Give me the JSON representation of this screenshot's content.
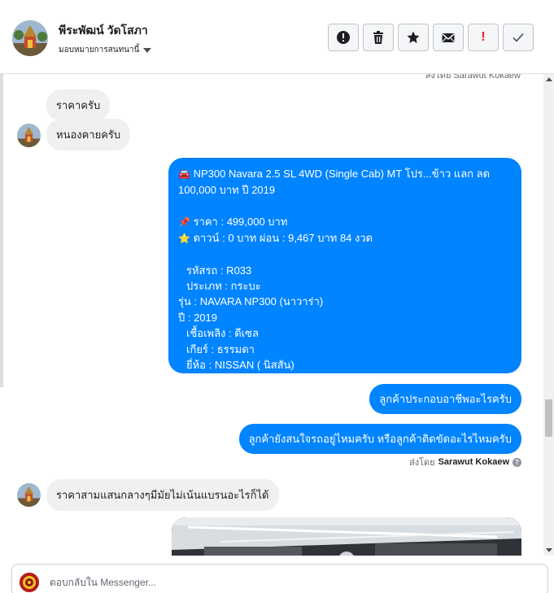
{
  "header": {
    "page_name": "พีระพัฒน์ วัดโสภา",
    "assign_label": "มอบหมายการสนทนานี้",
    "actions": [
      {
        "name": "report-button",
        "icon": "alert-circle-icon"
      },
      {
        "name": "delete-button",
        "icon": "trash-icon"
      },
      {
        "name": "star-button",
        "icon": "star-icon"
      },
      {
        "name": "mark-unread-button",
        "icon": "envelope-icon"
      },
      {
        "name": "spam-button",
        "icon": "exclamation-icon"
      },
      {
        "name": "mark-done-button",
        "icon": "check-icon"
      }
    ]
  },
  "messages": {
    "m1": "ราคาครับ",
    "m2": "หนองคายครับ",
    "listing": {
      "title_1": "NP300 Navara 2.5 SL 4WD (Single Cab) MT โปร...ข้าว แลก ลด",
      "title_2": "100,000 บาท ปี 2019",
      "price": "ราคา : 499,000 บาท",
      "down": "ดาวน์ : 0 บาท ผ่อน : 9,467 บาท 84 งวด",
      "code": "รหัสรถ : R033",
      "type": "ประเภท : กระบะ",
      "model": "รุ่น : NAVARA NP300 (นาวาร่า)",
      "year": "ปี : 2019",
      "fuel": "เชื้อเพลิง : ดีเซล",
      "gear": "เกียร์ : ธรรมดา",
      "brand": "ยี่ห้อ : NISSAN ( นิสสัน)"
    },
    "q1": "ลูกค้าประกอบอาชีพอะไรครับ",
    "q2": "ลูกค้ายังสนใจรถอยู่ไหมครับ หรือลูกค้าติดขัดอะไรไหมครับ",
    "sent_by_prefix": "ส่งโดย",
    "sent_by_name": "Sarawut Kokaew",
    "reply": "ราคาสามแสนกลางๆมีมัยไม่เน้นแบรนอะไรก็ได้",
    "cut_sent_by": "ส่งโดย Sarawut Kokaew"
  },
  "composer": {
    "placeholder": "ตอบกลับใน Messenger..."
  },
  "colors": {
    "outgoing": "#0084ff",
    "incoming": "#f1f0f0"
  }
}
